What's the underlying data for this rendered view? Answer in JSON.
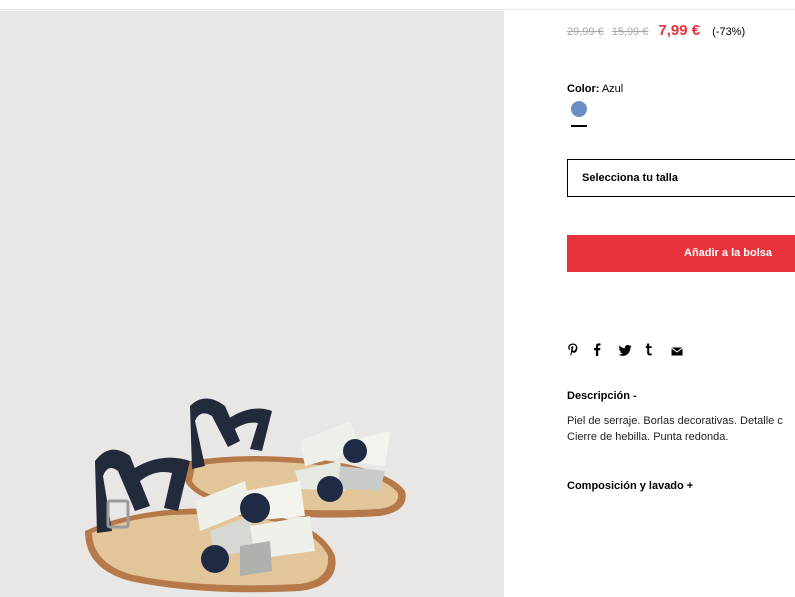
{
  "product": {
    "image_alt": "Sandalias piel borlas"
  },
  "pricing": {
    "original_price_1": "29,99 €",
    "original_price_2": "15,99 €",
    "sale_price": "7,99 €",
    "discount": "(-73%)"
  },
  "color": {
    "label": "Color:",
    "value": "Azul",
    "swatch_hex": "#6b8fc4"
  },
  "size_select": {
    "label": "Selecciona tu talla"
  },
  "cart": {
    "add_label": "Añadir a la bolsa",
    "accent": "#e8333c"
  },
  "share": {
    "icons": [
      "pinterest-icon",
      "facebook-icon",
      "twitter-icon",
      "tumblr-icon",
      "email-icon"
    ],
    "glyphs": [
      "℗",
      "f",
      "🐦",
      "t",
      "✉"
    ]
  },
  "description": {
    "title": "Descripción -",
    "line1": "Piel de serraje. Borlas decorativas. Detalle c",
    "line2": "Cierre de hebilla. Punta redonda."
  },
  "composition": {
    "title": "Composición y lavado +"
  }
}
